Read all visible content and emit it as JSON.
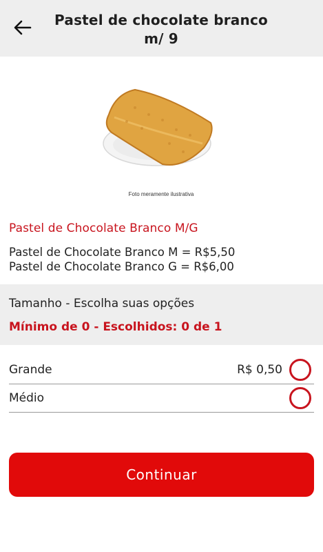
{
  "header": {
    "title": "Pastel de chocolate branco m/ 9",
    "back_icon": "arrow-left-icon"
  },
  "product": {
    "image_caption": "Foto meramente ilustrativa",
    "name": "Pastel de Chocolate Branco M/G",
    "description_lines": [
      "Pastel de Chocolate Branco M = R$5,50",
      "Pastel de Chocolate Branco G = R$6,00"
    ]
  },
  "options_group": {
    "title": "Tamanho - Escolha suas opções",
    "rule": "Mínimo de 0 - Escolhidos: 0 de 1",
    "options": [
      {
        "label": "Grande",
        "price": "R$ 0,50",
        "selected": false
      },
      {
        "label": "Médio",
        "price": "",
        "selected": false
      }
    ]
  },
  "actions": {
    "continue_label": "Continuar"
  },
  "colors": {
    "accent": "#c8141e",
    "button": "#e10a0a",
    "section_bg": "#eeeeee"
  }
}
